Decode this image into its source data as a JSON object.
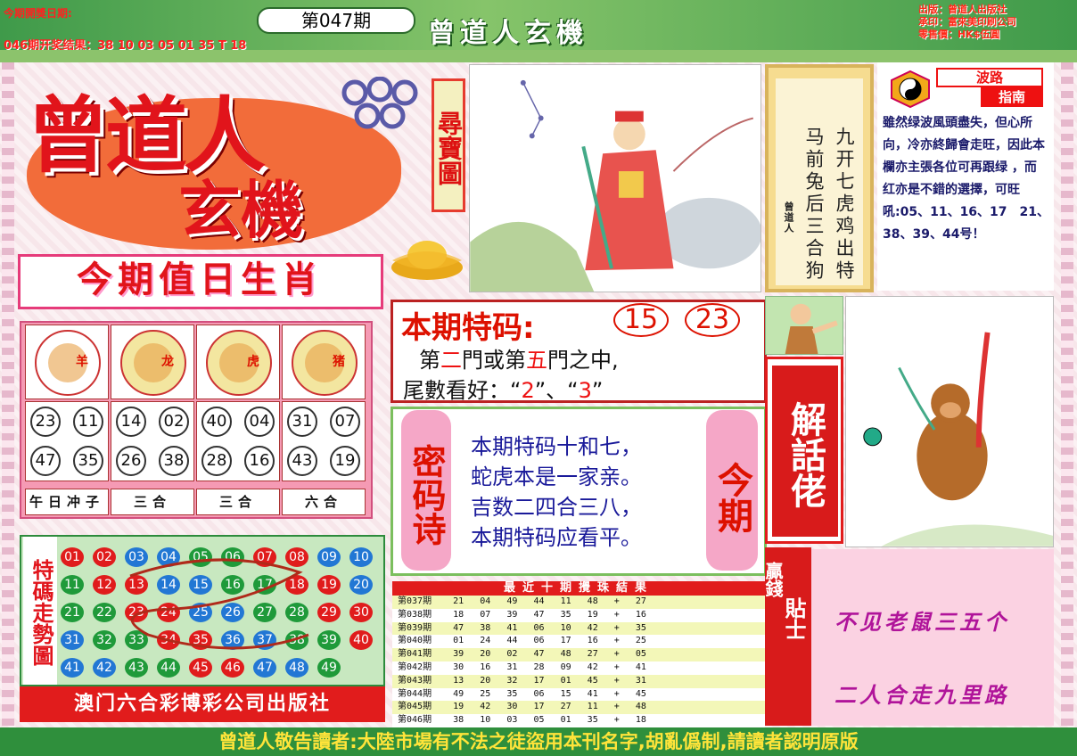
{
  "header": {
    "open_date_label": "今期開獎日期:",
    "last_result": "046期开奖结果：38 10 03 05 01 35 T 18",
    "issue": "第047期",
    "brand": "曾道人玄機",
    "publisher_lines": [
      "出版：曾道人出版社",
      "承印：富來美印刷公司",
      "零售價：HK$伍圓"
    ]
  },
  "logo": {
    "line1": "曾道人",
    "line2": "玄機",
    "treasure_label": "尋寶圖"
  },
  "scroll_poem": {
    "col1": "九开七虎鸡出特",
    "col2": "马前兔后三合狗",
    "sign": "曾道人"
  },
  "wave": {
    "title1": "波路",
    "title2": "指南",
    "text": "雖然绿波風頭盡失，但心所向，冷亦終歸會走旺，因此本欄亦主張各位可再跟绿 ，而 红亦是不錯的選擇，可旺吼:05、11、16、17　21、38、39、44号！"
  },
  "zodiac": {
    "heading": "今期值日生肖",
    "animals": [
      {
        "name": "羊",
        "icon": "goat-icon",
        "label": "午日冲子",
        "nums": [
          "23",
          "11",
          "47",
          "35"
        ]
      },
      {
        "name": "龙",
        "icon": "dragon-icon",
        "label": "三合",
        "nums": [
          "14",
          "02",
          "26",
          "38"
        ]
      },
      {
        "name": "虎",
        "icon": "tiger-icon",
        "label": "三合",
        "nums": [
          "40",
          "04",
          "28",
          "16"
        ]
      },
      {
        "name": "猪",
        "icon": "pig-icon",
        "label": "六合",
        "nums": [
          "31",
          "07",
          "43",
          "19"
        ]
      }
    ]
  },
  "trend": {
    "label": "特碼走勢圖",
    "balls": [
      [
        "01",
        "02",
        "03",
        "04",
        "05",
        "06",
        "07",
        "08",
        "09",
        "10"
      ],
      [
        "11",
        "12",
        "13",
        "14",
        "15",
        "16",
        "17",
        "18",
        "19",
        "20"
      ],
      [
        "21",
        "22",
        "23",
        "24",
        "25",
        "26",
        "27",
        "28",
        "29",
        "30"
      ],
      [
        "31",
        "32",
        "33",
        "34",
        "35",
        "36",
        "37",
        "38",
        "39",
        "40"
      ],
      [
        "41",
        "42",
        "43",
        "44",
        "45",
        "46",
        "47",
        "48",
        "49"
      ]
    ],
    "colors": {
      "red": "#e01c1c",
      "blue": "#2277d4",
      "green": "#1f9a3a"
    }
  },
  "publisher_bar": "澳门六合彩博彩公司出版社",
  "special": {
    "title": "本期特码:",
    "n1": "15",
    "n2": "23",
    "line2_a": "第",
    "line2_b": "二",
    "line2_c": "門或第",
    "line2_d": "五",
    "line2_e": "門之中,",
    "line3_a": "尾數看好：“",
    "line3_b": "2",
    "line3_c": "”、“",
    "line3_d": "3",
    "line3_e": "”"
  },
  "poem": {
    "left": "密码诗",
    "right": "今期",
    "lines": [
      "本期特码十和七，",
      "蛇虎本是一家亲。",
      "吉数二四合三八，",
      "本期特码应看平。"
    ]
  },
  "results": {
    "title": "最近十期攪珠結果",
    "rows": [
      "第037期    21   04   49   44   11   48   +   27",
      "第038期    18   07   39   47   35   19   +   16",
      "第039期    47   38   41   06   10   42   +   35",
      "第040期    01   24   44   06   17   16   +   25",
      "第041期    39   20   02   47   48   27   +   05",
      "第042期    30   16   31   28   09   42   +   41",
      "第043期    13   20   32   17   01   45   +   31",
      "第044期    49   25   35   06   15   41   +   45",
      "第045期    19   42   30   17   27   11   +   48",
      "第046期    38   10   03   05   01   35   +   18"
    ]
  },
  "jie": {
    "label": "解話佬"
  },
  "tip": {
    "side1": "贏錢",
    "side2": "貼士",
    "line1": "不见老鼠三五个",
    "line2": "二人合走九里路"
  },
  "warning": "曾道人敬告讀者:大陸市場有不法之徒盜用本刊名字,胡亂僞制,請讀者認明原版"
}
